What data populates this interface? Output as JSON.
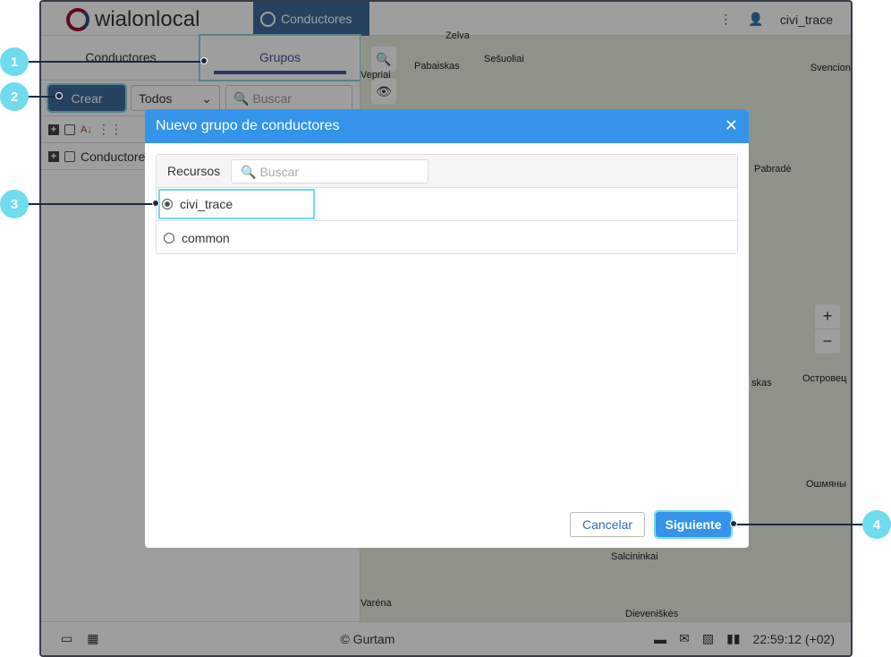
{
  "header": {
    "logo": "wialonlocal",
    "module": "Conductores",
    "user": "civi_trace"
  },
  "left": {
    "tabs": [
      "Conductores",
      "Grupos"
    ],
    "create": "Crear",
    "filter": "Todos",
    "search_placeholder": "Buscar",
    "row": "Conductores"
  },
  "map": {
    "labels": [
      "Zelva",
      "Pabaiskas",
      "Sešuoliai",
      "Vepriai",
      "Svencion",
      "Pabradė",
      "skas",
      "Островец",
      "Ошмяны",
      "Salcininkai",
      "Varėna",
      "Dieveniškės"
    ]
  },
  "footer": {
    "copyright": "© Gurtam",
    "time": "22:59:12 (+02)"
  },
  "modal": {
    "title": "Nuevo grupo de conductores",
    "resources_label": "Recursos",
    "search_placeholder": "Buscar",
    "options": [
      {
        "label": "civi_trace",
        "selected": true
      },
      {
        "label": "common",
        "selected": false
      }
    ],
    "cancel": "Cancelar",
    "next": "Siguiente"
  },
  "callouts": [
    "1",
    "2",
    "3",
    "4"
  ]
}
